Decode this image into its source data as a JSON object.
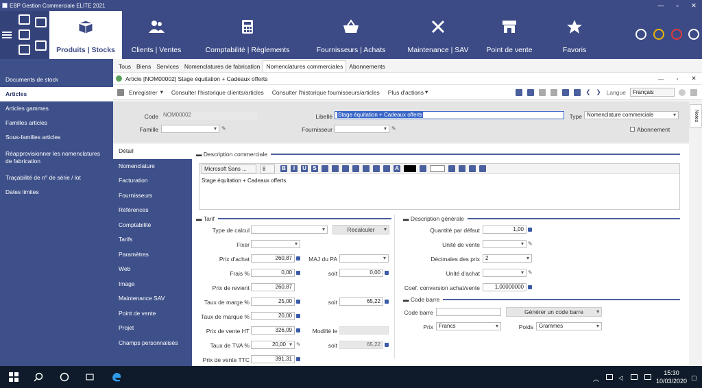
{
  "window": {
    "title": "EBP Gestion Commerciale ELITE 2021"
  },
  "nav": {
    "items": [
      {
        "label": "Produits | Stocks",
        "icon": "box-icon"
      },
      {
        "label": "Clients | Ventes",
        "icon": "users-icon"
      },
      {
        "label": "Comptabilité | Règlements",
        "icon": "calculator-icon"
      },
      {
        "label": "Fournisseurs | Achats",
        "icon": "basket-icon"
      },
      {
        "label": "Maintenance | SAV",
        "icon": "tools-icon"
      },
      {
        "label": "Point de vente",
        "icon": "store-icon"
      },
      {
        "label": "Favoris",
        "icon": "star-icon"
      }
    ]
  },
  "sidebar": {
    "items": [
      {
        "label": "Documents de stock"
      },
      {
        "label": "Articles"
      },
      {
        "label": "Articles gammes"
      },
      {
        "label": "Familles articles"
      },
      {
        "label": "Sous-familles articles"
      },
      {
        "label": "Réapprovisionner les nomenclatures de fabrication"
      },
      {
        "label": "Traçabilité de n° de série / lot"
      },
      {
        "label": "Dates limites"
      }
    ]
  },
  "tabs": [
    "Tous",
    "Biens",
    "Services",
    "Nomenclatures de fabrication",
    "Nomenclatures commerciales",
    "Abonnements"
  ],
  "doc": {
    "title": "Article [NOM00002] Stage équitation + Cadeaux offerts"
  },
  "toolbar": {
    "save": "Enregistrer",
    "history_clients": "Consulter l'historique clients/articles",
    "history_suppliers": "Consulter l'historique fournisseurs/articles",
    "more": "Plus d'actions",
    "lang_label": "Langue",
    "lang_value": "Français"
  },
  "header": {
    "code_label": "Code",
    "code_value": "NOM00002",
    "libelle_label": "Libellé",
    "libelle_value": "Stage équitation + Cadeaux offerts",
    "type_label": "Type",
    "type_value": "Nomenclature commerciale",
    "famille_label": "Famille",
    "fournisseur_label": "Fournisseur",
    "abonnement_label": "Abonnement",
    "notes": "Notes"
  },
  "vtabs": [
    "Détail",
    "Nomenclature",
    "Facturation",
    "Fournisseurs",
    "Références",
    "Comptabilité",
    "Tarifs",
    "Paramètres",
    "Web",
    "Image",
    "Maintenance SAV",
    "Point de vente",
    "Projet",
    "Champs personnalisés"
  ],
  "desc": {
    "title": "Description commerciale",
    "font": "Microsoft Sans ...",
    "size": "8",
    "text": "Stage équitation + Cadeaux offerts"
  },
  "tarif": {
    "title": "Tarif",
    "type_calcul": "Type de calcul",
    "recalculer": "Recalculer",
    "fixer": "Fixer",
    "prix_achat_label": "Prix d'achat",
    "prix_achat": "260,87",
    "maj_pa": "MAJ du PA",
    "frais_label": "Frais %",
    "frais": "0,00",
    "soit1": "soit",
    "soit1_value": "0,00",
    "prix_revient_label": "Prix de revient",
    "prix_revient": "260,87",
    "taux_marge_label": "Taux de marge %",
    "taux_marge": "25,00",
    "soit2": "soit",
    "soit2_value": "65,22",
    "taux_marque_label": "Taux de marque %",
    "taux_marque": "20,00",
    "prix_vente_ht_label": "Prix de vente HT",
    "prix_vente_ht": "326,09",
    "modifie_le": "Modifié le",
    "tva_label": "Taux de TVA %",
    "tva": "20,00",
    "soit3": "soit",
    "soit3_value": "65,22",
    "prix_ttc_label": "Prix de vente TTC",
    "prix_ttc": "391,31"
  },
  "general": {
    "title": "Description générale",
    "qte_label": "Quantité par défaut",
    "qte": "1,00",
    "unite_vente": "Unité de vente",
    "decimales_label": "Décimales des prix",
    "decimales": "2",
    "unite_achat": "Unité d'achat",
    "coef_label": "Coef. conversion achat/vente",
    "coef": "1,00000000"
  },
  "barcode": {
    "title": "Code barre",
    "label": "Code barre",
    "generate": "Générer un code barre",
    "prix_label": "Prix",
    "prix_value": "Francs",
    "poids_label": "Poids",
    "poids_value": "Grammes"
  },
  "taskbar": {
    "time": "15:30",
    "date": "10/03/2020"
  }
}
